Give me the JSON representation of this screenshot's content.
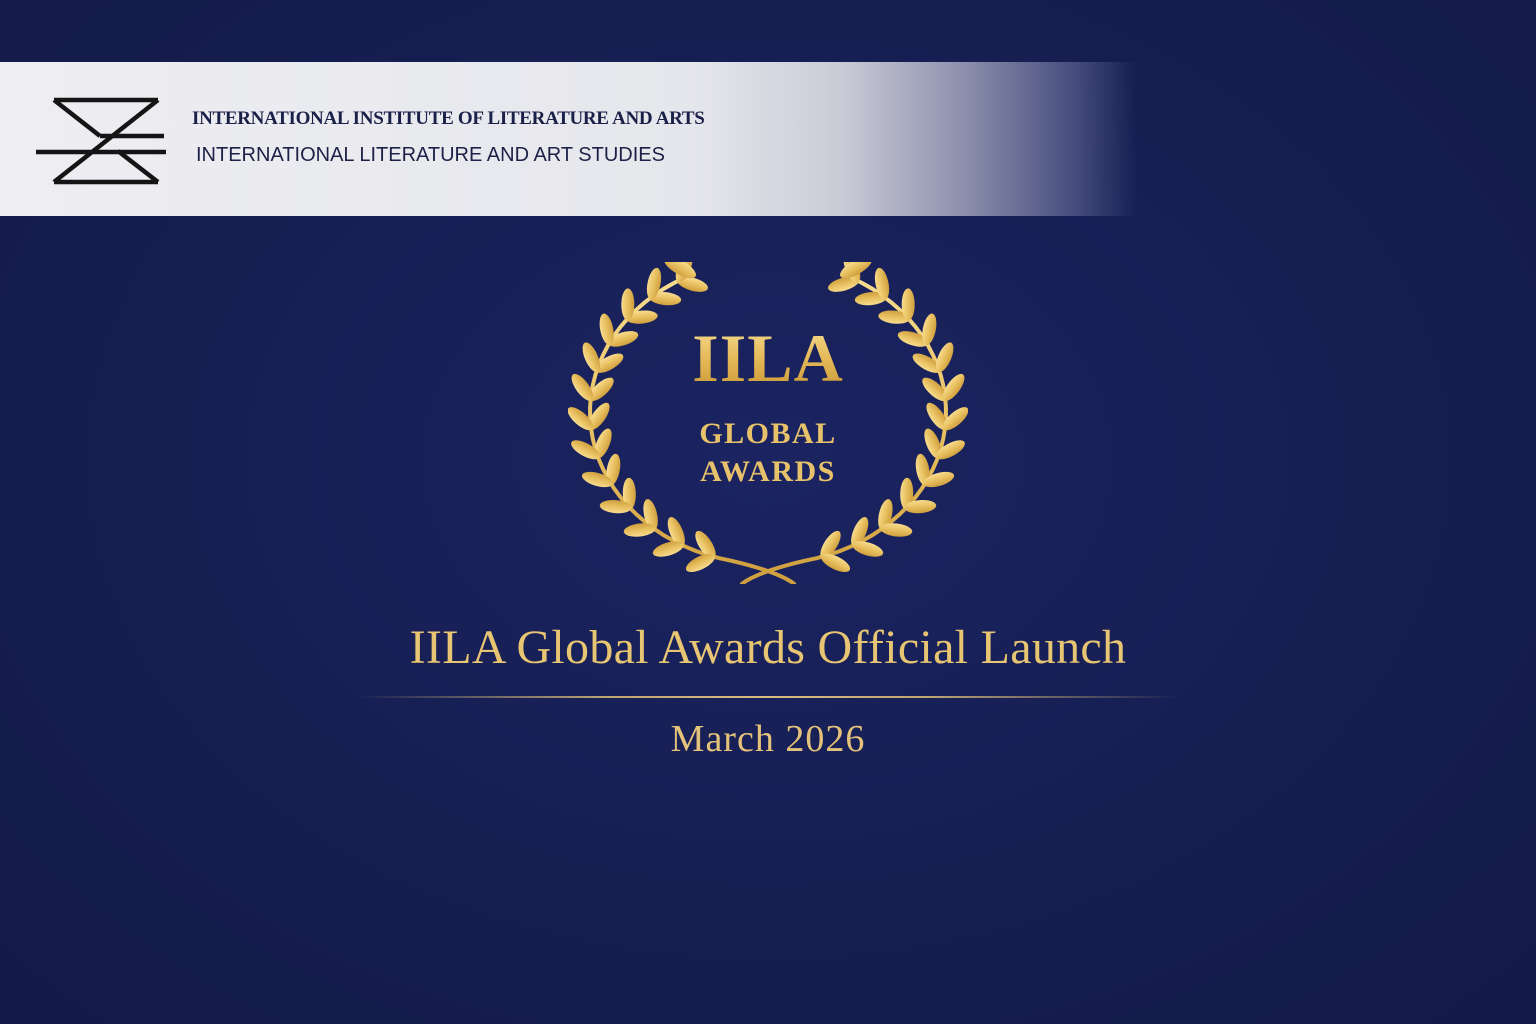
{
  "header": {
    "institute_name": "INTERNATIONAL INSTITUTE OF LITERATURE AND ARTS",
    "institute_subtitle": "INTERNATIONAL LITERATURE AND ART STUDIES",
    "logo_icon": "hourglass-monogram-icon"
  },
  "emblem": {
    "title": "IILA",
    "line1": "GLOBAL",
    "line2": "AWARDS",
    "icon": "laurel-wreath-icon"
  },
  "announcement": {
    "title": "IILA Global Awards Official Launch",
    "date": "March 2026"
  },
  "colors": {
    "background": "#151d4e",
    "gold": "#e8c572",
    "header_band": "#eeeef2",
    "header_text": "#1a2048"
  }
}
